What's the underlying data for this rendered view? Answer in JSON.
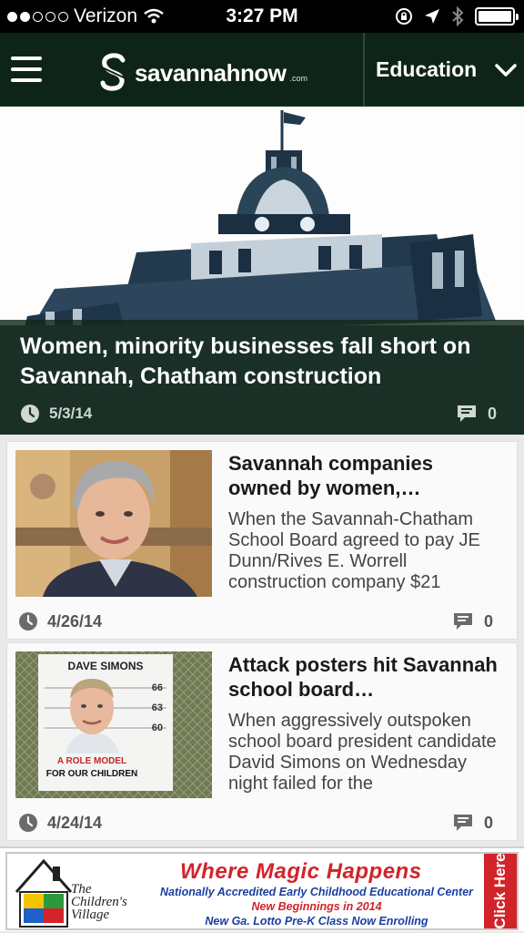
{
  "status_bar": {
    "carrier": "Verizon",
    "time": "3:27 PM",
    "signal_bars_filled": 2,
    "signal_bars_total": 5,
    "battery_level": 1.0
  },
  "navbar": {
    "logo_text": "savannahnow",
    "logo_suffix": ".com",
    "section": "Education"
  },
  "hero": {
    "title": "Women, minority businesses fall short on Savannah, Chatham construction",
    "date": "5/3/14",
    "comments": "0"
  },
  "articles": [
    {
      "title": "Savannah companies owned by women,…",
      "excerpt": "When the Savannah-Chatham School Board agreed to pay JE Dunn/Rives E. Worrell construction company $21",
      "date": "4/26/14",
      "comments": "0"
    },
    {
      "title": "Attack posters hit Savannah school board…",
      "excerpt": "When aggressively outspoken school board president candidate David Simons on Wednesday night failed for the",
      "date": "4/24/14",
      "comments": "0",
      "poster_name": "DAVE SIMONS",
      "poster_tagline_1": "A ROLE MODEL",
      "poster_tagline_2": "FOR OUR CHILDREN",
      "height_marks": [
        "66",
        "63",
        "60"
      ]
    }
  ],
  "ad": {
    "logo_line1": "The",
    "logo_line2": "Children's",
    "logo_line3": "Village",
    "title": "Where Magic Happens",
    "line1": "Nationally Accredited Early Childhood Educational Center",
    "line2": "New Beginnings in 2014",
    "line3": "New Ga. Lotto Pre-K Class Now Enrolling",
    "cta": "Click Here"
  },
  "colors": {
    "nav_bg": "#0f2418",
    "overlay": "#12281a",
    "ad_red": "#d3232a",
    "ad_blue": "#1b3ea0"
  }
}
